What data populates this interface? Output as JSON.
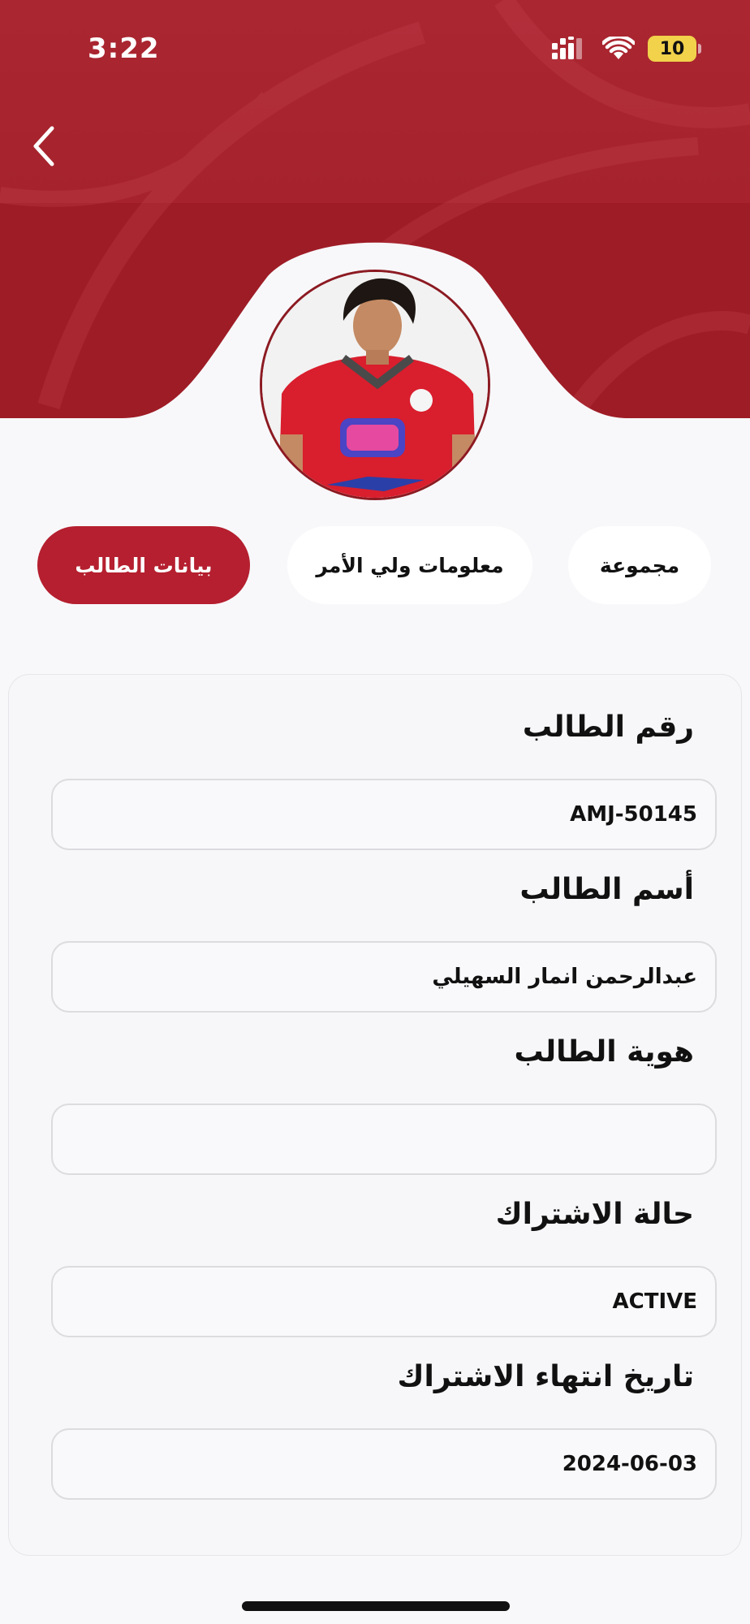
{
  "status_bar": {
    "time": "3:22",
    "battery": "10"
  },
  "tabs": [
    {
      "label": "مجموعة",
      "active": false
    },
    {
      "label": "معلومات ولي الأمر",
      "active": false
    },
    {
      "label": "بيانات الطالب",
      "active": true
    }
  ],
  "fields": [
    {
      "label": "رقم الطالب",
      "value": "AMJ-50145"
    },
    {
      "label": "أسم الطالب",
      "value": "عبدالرحمن انمار السهيلي"
    },
    {
      "label": "هوية الطالب",
      "value": ""
    },
    {
      "label": "حالة الاشتراك",
      "value": "ACTIVE"
    },
    {
      "label": "تاريخ انتهاء الاشتراك",
      "value": "2024-06-03"
    }
  ],
  "colors": {
    "header": "#9e1c26",
    "active_tab": "#b51f2f",
    "background": "#f8f8fa"
  },
  "icons": [
    "back-chevron-icon",
    "cellular-signal-icon",
    "wifi-icon",
    "battery-icon"
  ]
}
